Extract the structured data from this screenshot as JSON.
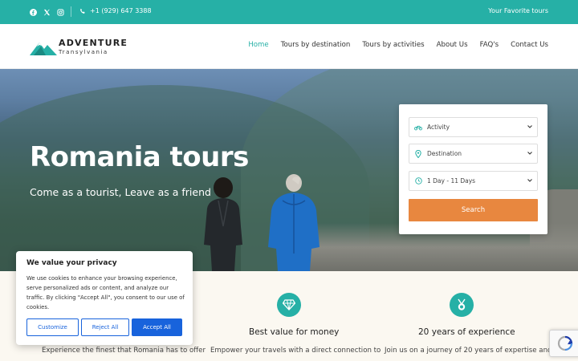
{
  "topbar": {
    "phone": "+1 (929) 647 3388",
    "tagline": "Your Favorite tours",
    "social": [
      "facebook-icon",
      "x-icon",
      "instagram-icon"
    ]
  },
  "logo": {
    "brand": "ADVENTURE",
    "sub": "Transylvania"
  },
  "nav": {
    "items": [
      "Home",
      "Tours by destination",
      "Tours by activities",
      "About Us",
      "FAQ's",
      "Contact Us"
    ],
    "active": "Home"
  },
  "hero": {
    "title": "Romania tours",
    "subtitle": "Come as a tourist, Leave as a friend"
  },
  "search": {
    "activity": "Activity",
    "destination": "Destination",
    "duration": "1 Day - 11 Days",
    "button": "Search"
  },
  "features": [
    {
      "icon": "award-icon",
      "title": "",
      "text": "Experience the finest that Romania has to offer"
    },
    {
      "icon": "diamond-icon",
      "title": "Best value for money",
      "text": "Empower your travels with a direct connection to"
    },
    {
      "icon": "medal-icon",
      "title": "20 years of experience",
      "text": "Join us on a journey of 20 years of expertise and"
    }
  ],
  "cookie": {
    "title": "We value your privacy",
    "text": "We use cookies to enhance your browsing experience, serve personalized ads or content, and analyze our traffic. By clicking \"Accept All\", you consent to our use of cookies.",
    "customize": "Customize",
    "reject": "Reject All",
    "accept": "Accept All"
  },
  "colors": {
    "teal": "#26b0a6",
    "orange": "#e8873f",
    "blue": "#1863dc",
    "cream": "#fbf8f1"
  }
}
